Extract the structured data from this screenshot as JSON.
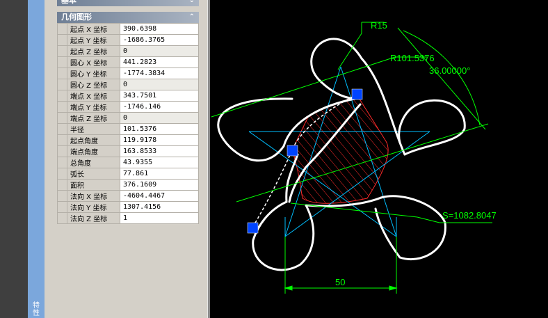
{
  "vertical_tab": {
    "label": "特性"
  },
  "sections": {
    "basic": {
      "title": "基本",
      "chevron": "⌄"
    },
    "geometry": {
      "title": "几何图形",
      "chevron": "⌃"
    }
  },
  "properties": [
    {
      "name": "起点 X 坐标",
      "value": "390.6398"
    },
    {
      "name": "起点 Y 坐标",
      "value": "-1686.3765"
    },
    {
      "name": "起点 Z 坐标",
      "value": "0"
    },
    {
      "name": "圆心 X 坐标",
      "value": "441.2823"
    },
    {
      "name": "圆心 Y 坐标",
      "value": "-1774.3834"
    },
    {
      "name": "圆心 Z 坐标",
      "value": "0"
    },
    {
      "name": "端点 X 坐标",
      "value": "343.7501"
    },
    {
      "name": "端点 Y 坐标",
      "value": "-1746.146"
    },
    {
      "name": "端点 Z 坐标",
      "value": "0"
    },
    {
      "name": "半径",
      "value": "101.5376"
    },
    {
      "name": "起点角度",
      "value": "119.9178"
    },
    {
      "name": "端点角度",
      "value": "163.8533"
    },
    {
      "name": "总角度",
      "value": "43.9355"
    },
    {
      "name": "弧长",
      "value": "77.861"
    },
    {
      "name": "面积",
      "value": "376.1609"
    },
    {
      "name": "法向 X 坐标",
      "value": "-4604.4467"
    },
    {
      "name": "法向 Y 坐标",
      "value": "1307.4156"
    },
    {
      "name": "法向 Z 坐标",
      "value": "1"
    }
  ],
  "drawing": {
    "dim_r15": "R15",
    "dim_r101": "R101.5376",
    "dim_angle": "36.00000°",
    "dim_area": "S=1082.8047",
    "dim_width": "50",
    "colors": {
      "background": "#000000",
      "dimension": "#00ff00",
      "star": "#00bfff",
      "outline": "#ffffff",
      "grip": "#0044ff",
      "hatch": "#ff2a2a"
    }
  }
}
